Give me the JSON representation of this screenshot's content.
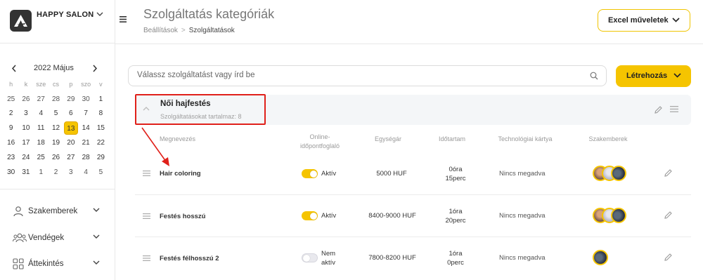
{
  "sidebar": {
    "brand": "HAPPY SALON",
    "calendar": {
      "title": "2022 Május",
      "weekdays": [
        "h",
        "k",
        "sze",
        "cs",
        "p",
        "szo",
        "v"
      ],
      "weeks": [
        [
          "25",
          "26",
          "27",
          "28",
          "29",
          "30",
          "1"
        ],
        [
          "2",
          "3",
          "4",
          "5",
          "6",
          "7",
          "8"
        ],
        [
          "9",
          "10",
          "11",
          "12",
          "13",
          "14",
          "15"
        ],
        [
          "16",
          "17",
          "18",
          "19",
          "20",
          "21",
          "22"
        ],
        [
          "23",
          "24",
          "25",
          "26",
          "27",
          "28",
          "29"
        ],
        [
          "30",
          "31",
          "1",
          "2",
          "3",
          "4",
          "5"
        ]
      ],
      "selected": "13"
    },
    "nav": [
      {
        "label": "Szakemberek",
        "icon": "user-icon"
      },
      {
        "label": "Vendégek",
        "icon": "users-icon"
      },
      {
        "label": "Áttekintés",
        "icon": "grid-icon"
      }
    ]
  },
  "header": {
    "title": "Szolgáltatás kategóriák",
    "breadcrumb": [
      "Beállítások",
      "Szolgáltatások"
    ],
    "excel_button": "Excel műveletek"
  },
  "search": {
    "placeholder": "Válassz szolgáltatást vagy írd be"
  },
  "create_button": "Létrehozás",
  "category": {
    "title": "Női hajfestés",
    "subtitle": "Szolgáltatásokat tartalmaz: 8"
  },
  "table": {
    "headers": {
      "name": "Megnevezés",
      "online_1": "Online-",
      "online_2": "időpontfoglaló",
      "price": "Egységár",
      "duration": "Időtartam",
      "tech": "Technológiai kártya",
      "staff": "Szakemberek"
    },
    "rows": [
      {
        "name": "Hair coloring",
        "online_label": "Aktív",
        "online_label_2": "",
        "online_on": true,
        "price": "5000 HUF",
        "duration_1": "0óra",
        "duration_2": "15perc",
        "tech": "Nincs megadva"
      },
      {
        "name": "Festés hosszú",
        "online_label": "Aktív",
        "online_label_2": "",
        "online_on": true,
        "price": "8400-9000 HUF",
        "duration_1": "1óra",
        "duration_2": "20perc",
        "tech": "Nincs megadva"
      },
      {
        "name": "Festés félhosszú 2",
        "online_label": "Nem",
        "online_label_2": "aktív",
        "online_on": false,
        "price": "7800-8200 HUF",
        "duration_1": "1óra",
        "duration_2": "0perc",
        "tech": "Nincs megadva"
      }
    ]
  },
  "colors": {
    "accent": "#f5c400",
    "highlight": "#e0201a"
  }
}
